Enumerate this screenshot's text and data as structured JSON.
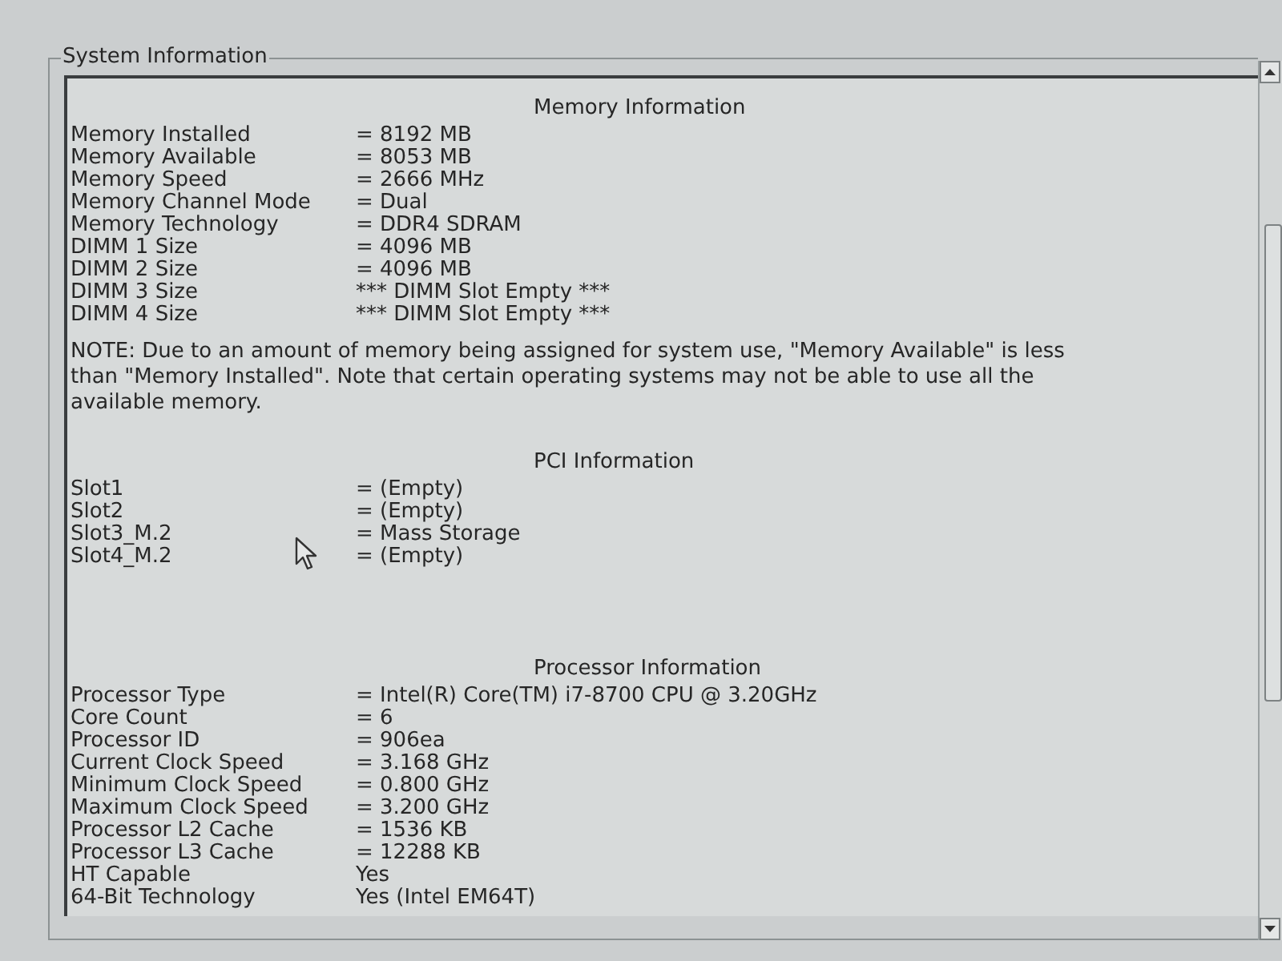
{
  "group_box": {
    "title": "System Information"
  },
  "sections": [
    {
      "title": "Memory Information",
      "rows": [
        {
          "label": "Memory Installed",
          "value": "= 8192 MB"
        },
        {
          "label": "Memory Available",
          "value": "= 8053 MB"
        },
        {
          "label": "Memory Speed",
          "value": "= 2666 MHz"
        },
        {
          "label": "Memory Channel Mode",
          "value": "= Dual"
        },
        {
          "label": "Memory Technology",
          "value": "= DDR4 SDRAM"
        },
        {
          "label": "DIMM 1 Size",
          "value": "= 4096 MB"
        },
        {
          "label": "DIMM 2 Size",
          "value": "= 4096 MB"
        },
        {
          "label": "DIMM 3 Size",
          "value": "*** DIMM Slot Empty ***"
        },
        {
          "label": "DIMM 4 Size",
          "value": "*** DIMM Slot Empty ***"
        }
      ],
      "note": "NOTE: Due to an amount of memory being assigned for system use, \"Memory Available\" is less than \"Memory Installed\". Note that certain operating systems may not be able to use all the available memory."
    },
    {
      "title": "PCI Information",
      "rows": [
        {
          "label": "Slot1",
          "value": "= (Empty)"
        },
        {
          "label": "Slot2",
          "value": "= (Empty)"
        },
        {
          "label": "Slot3_M.2",
          "value": "= Mass Storage"
        },
        {
          "label": "Slot4_M.2",
          "value": "= (Empty)"
        }
      ]
    },
    {
      "title": "Processor Information",
      "rows": [
        {
          "label": "Processor Type",
          "value": "= Intel(R) Core(TM) i7-8700 CPU @ 3.20GHz"
        },
        {
          "label": "Core Count",
          "value": "= 6"
        },
        {
          "label": "Processor ID",
          "value": "= 906ea"
        },
        {
          "label": "Current Clock Speed",
          "value": "= 3.168 GHz"
        },
        {
          "label": "Minimum Clock Speed",
          "value": "= 0.800 GHz"
        },
        {
          "label": "Maximum Clock Speed",
          "value": "= 3.200 GHz"
        },
        {
          "label": "Processor L2 Cache",
          "value": "= 1536 KB"
        },
        {
          "label": "Processor L3 Cache",
          "value": "= 12288 KB"
        },
        {
          "label": "HT Capable",
          "value": "Yes"
        },
        {
          "label": "64-Bit Technology",
          "value": "Yes (Intel EM64T)"
        }
      ]
    }
  ]
}
